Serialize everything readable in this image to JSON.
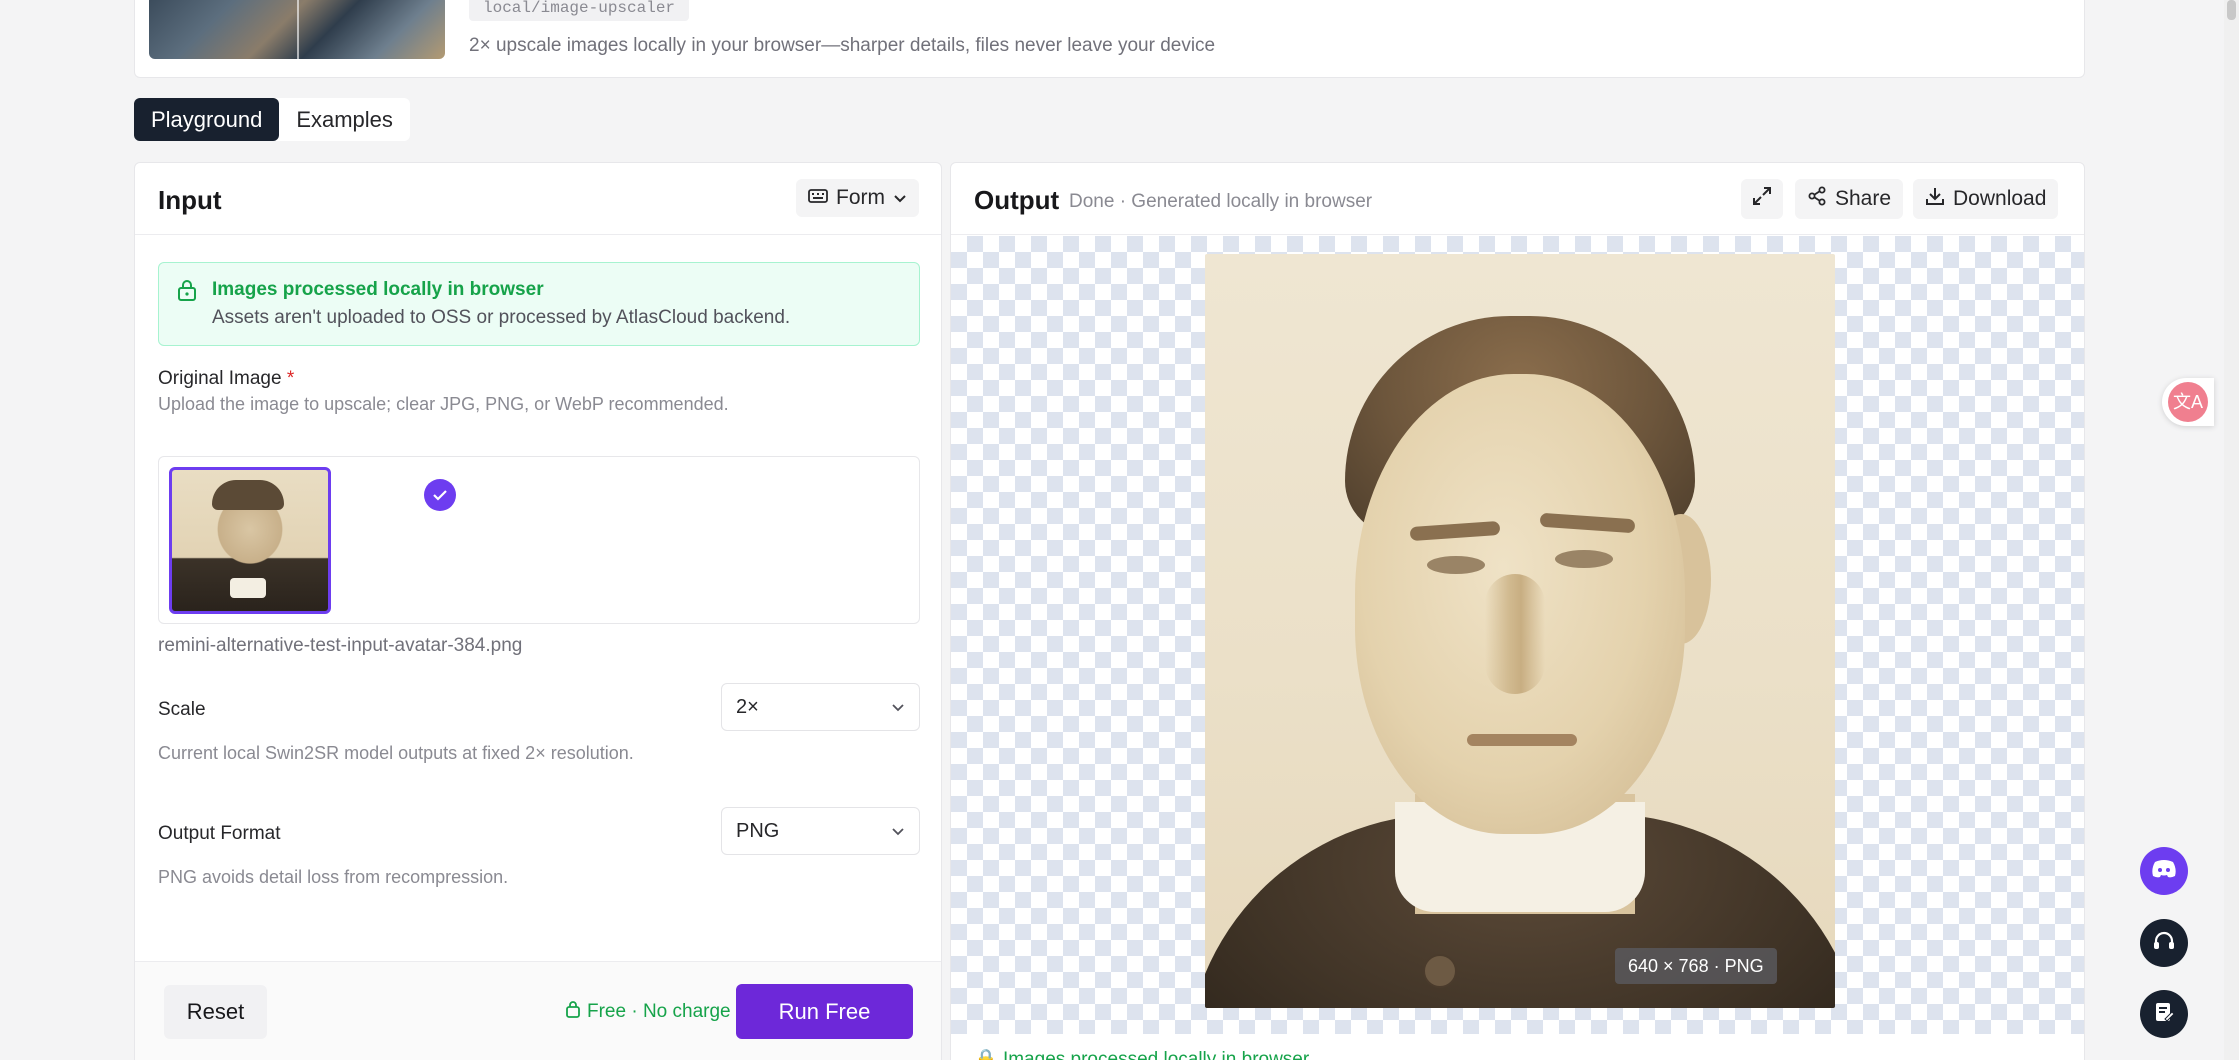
{
  "header": {
    "path_tag": "local/image-upscaler",
    "description": "2× upscale images locally in your browser—sharper details, files never leave your device"
  },
  "tabs": [
    {
      "label": "Playground",
      "active": true
    },
    {
      "label": "Examples",
      "active": false
    }
  ],
  "input": {
    "title": "Input",
    "view_mode": "Form",
    "notice": {
      "title": "Images processed locally in browser",
      "subtitle": "Assets aren't uploaded to OSS or processed by AtlasCloud backend."
    },
    "original_image": {
      "label": "Original Image",
      "required_mark": "*",
      "help": "Upload the image to upscale; clear JPG, PNG, or WebP recommended.",
      "file_name": "remini-alternative-test-input-avatar-384.png"
    },
    "scale": {
      "label": "Scale",
      "value": "2×",
      "help": "Current local Swin2SR model outputs at fixed 2× resolution."
    },
    "output_format": {
      "label": "Output Format",
      "value": "PNG",
      "help": "PNG avoids detail loss from recompression."
    },
    "footer": {
      "reset_label": "Reset",
      "free_label": "Free · No charge",
      "run_label": "Run Free"
    }
  },
  "output": {
    "title": "Output",
    "status": "Done · Generated locally in browser",
    "share_label": "Share",
    "download_label": "Download",
    "dimensions": "640 × 768 · PNG",
    "notice": "Images processed locally in browser"
  },
  "colors": {
    "accent": "#6d28d9",
    "dark": "#18212f",
    "success": "#16a34a"
  },
  "icons": [
    "expand-icon",
    "share-icon",
    "download-icon",
    "lock-icon",
    "chevron-down-icon",
    "check-icon",
    "translate-icon",
    "discord-icon",
    "headset-icon",
    "note-icon"
  ]
}
